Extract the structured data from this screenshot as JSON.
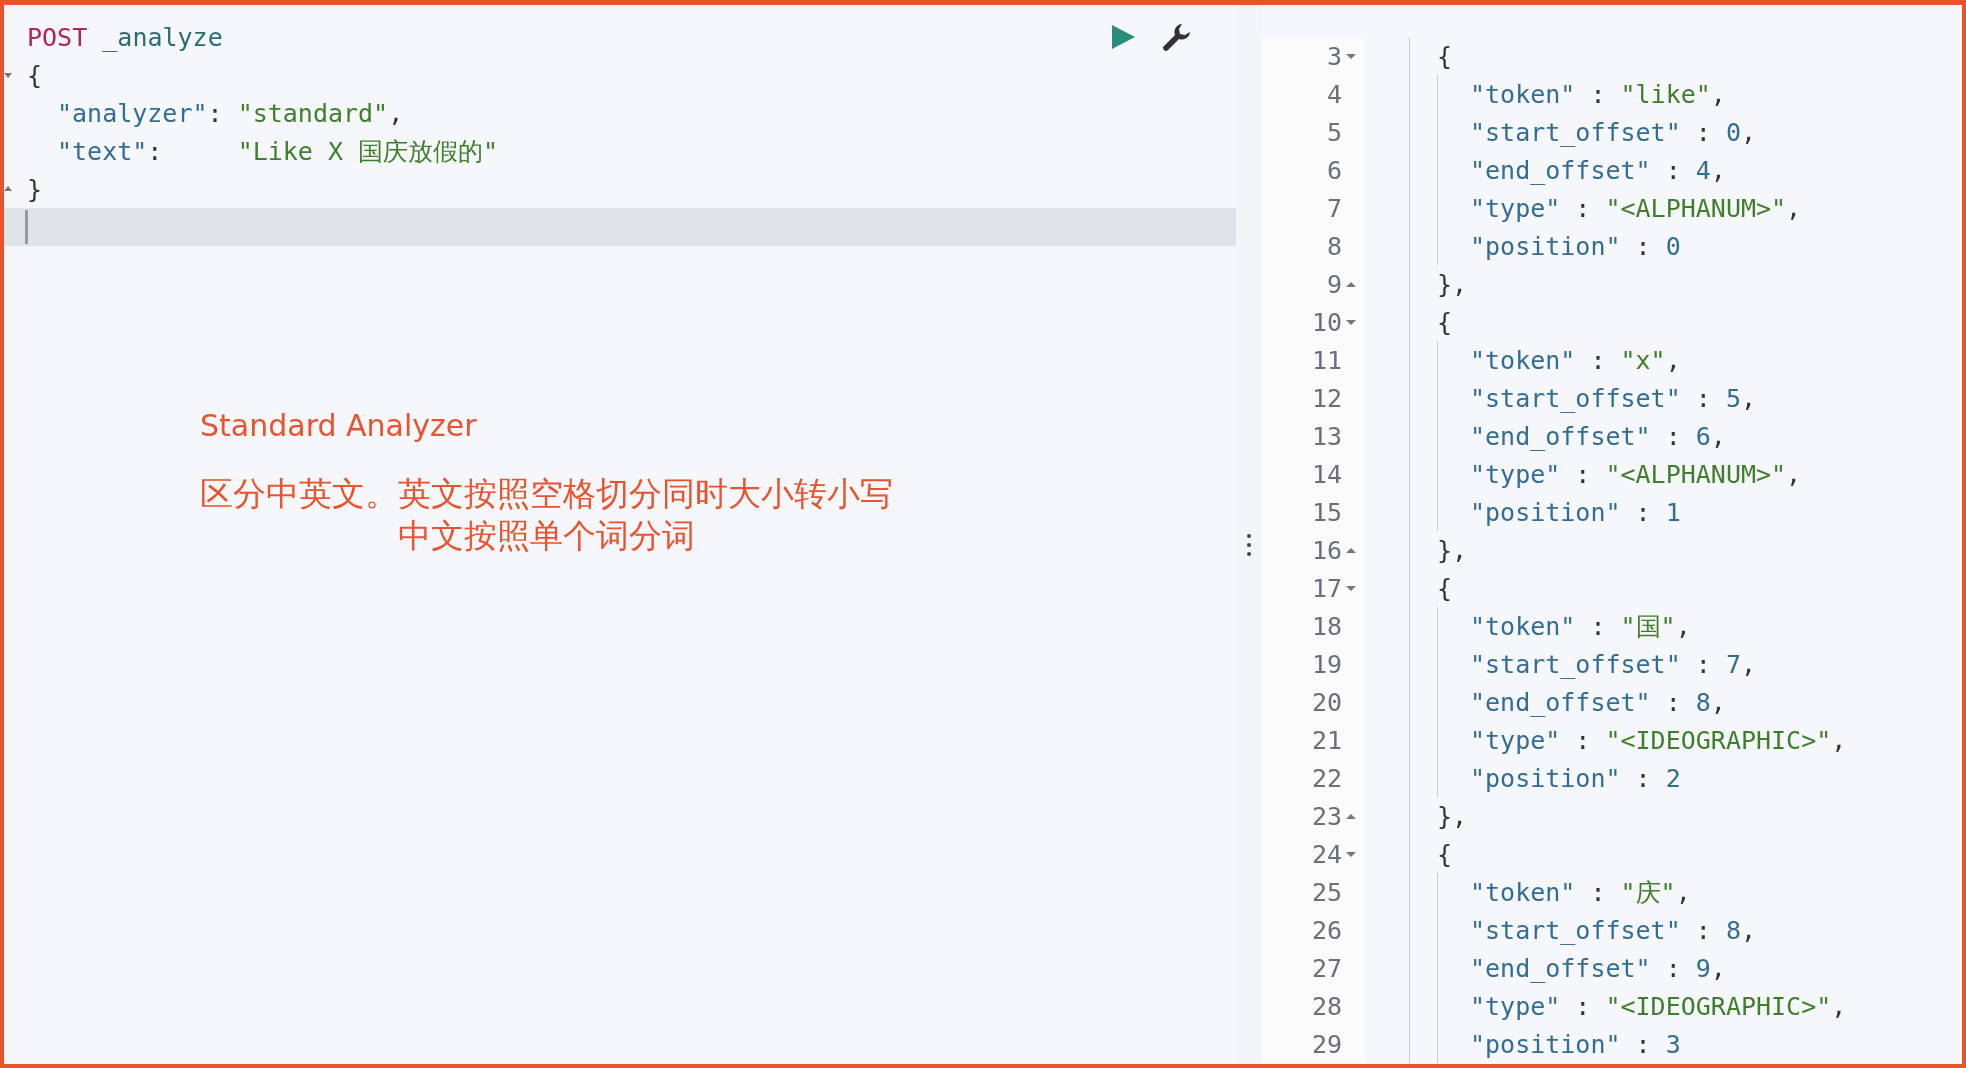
{
  "request": {
    "method": "POST",
    "path": "_analyze",
    "open": "{",
    "fields": [
      {
        "parts": [
          {
            "kind": "key",
            "text": "\"analyzer\""
          },
          {
            "kind": "punct",
            "text": ": "
          },
          {
            "kind": "string",
            "text": "\"standard\""
          },
          {
            "kind": "punct",
            "text": ","
          }
        ]
      },
      {
        "parts": [
          {
            "kind": "key",
            "text": "\"text\""
          },
          {
            "kind": "punct",
            "text": ":     "
          },
          {
            "kind": "string",
            "text": "\"Like X 国庆放假的\""
          }
        ]
      }
    ],
    "close": "}"
  },
  "note": {
    "title": "Standard Analyzer",
    "lines": [
      "区分中英文。英文按照空格切分同时大小转小写",
      "中文按照单个词分词"
    ]
  },
  "response": {
    "tokens": [
      {
        "open_line": "3",
        "open": "{",
        "fields": [
          {
            "line": "4",
            "parts": [
              {
                "kind": "key",
                "text": "\"token\""
              },
              {
                "kind": "punct",
                "text": " : "
              },
              {
                "kind": "string",
                "text": "\"like\""
              },
              {
                "kind": "punct",
                "text": ","
              }
            ]
          },
          {
            "line": "5",
            "parts": [
              {
                "kind": "key",
                "text": "\"start_offset\""
              },
              {
                "kind": "punct",
                "text": " : "
              },
              {
                "kind": "number",
                "text": "0"
              },
              {
                "kind": "punct",
                "text": ","
              }
            ]
          },
          {
            "line": "6",
            "parts": [
              {
                "kind": "key",
                "text": "\"end_offset\""
              },
              {
                "kind": "punct",
                "text": " : "
              },
              {
                "kind": "number",
                "text": "4"
              },
              {
                "kind": "punct",
                "text": ","
              }
            ]
          },
          {
            "line": "7",
            "parts": [
              {
                "kind": "key",
                "text": "\"type\""
              },
              {
                "kind": "punct",
                "text": " : "
              },
              {
                "kind": "string",
                "text": "\"<ALPHANUM>\""
              },
              {
                "kind": "punct",
                "text": ","
              }
            ]
          },
          {
            "line": "8",
            "parts": [
              {
                "kind": "key",
                "text": "\"position\""
              },
              {
                "kind": "punct",
                "text": " : "
              },
              {
                "kind": "number",
                "text": "0"
              }
            ]
          }
        ],
        "close_line": "9",
        "close": "},"
      },
      {
        "open_line": "10",
        "open": "{",
        "fields": [
          {
            "line": "11",
            "parts": [
              {
                "kind": "key",
                "text": "\"token\""
              },
              {
                "kind": "punct",
                "text": " : "
              },
              {
                "kind": "string",
                "text": "\"x\""
              },
              {
                "kind": "punct",
                "text": ","
              }
            ]
          },
          {
            "line": "12",
            "parts": [
              {
                "kind": "key",
                "text": "\"start_offset\""
              },
              {
                "kind": "punct",
                "text": " : "
              },
              {
                "kind": "number",
                "text": "5"
              },
              {
                "kind": "punct",
                "text": ","
              }
            ]
          },
          {
            "line": "13",
            "parts": [
              {
                "kind": "key",
                "text": "\"end_offset\""
              },
              {
                "kind": "punct",
                "text": " : "
              },
              {
                "kind": "number",
                "text": "6"
              },
              {
                "kind": "punct",
                "text": ","
              }
            ]
          },
          {
            "line": "14",
            "parts": [
              {
                "kind": "key",
                "text": "\"type\""
              },
              {
                "kind": "punct",
                "text": " : "
              },
              {
                "kind": "string",
                "text": "\"<ALPHANUM>\""
              },
              {
                "kind": "punct",
                "text": ","
              }
            ]
          },
          {
            "line": "15",
            "parts": [
              {
                "kind": "key",
                "text": "\"position\""
              },
              {
                "kind": "punct",
                "text": " : "
              },
              {
                "kind": "number",
                "text": "1"
              }
            ]
          }
        ],
        "close_line": "16",
        "close": "},"
      },
      {
        "open_line": "17",
        "open": "{",
        "fields": [
          {
            "line": "18",
            "parts": [
              {
                "kind": "key",
                "text": "\"token\""
              },
              {
                "kind": "punct",
                "text": " : "
              },
              {
                "kind": "string",
                "text": "\"国\""
              },
              {
                "kind": "punct",
                "text": ","
              }
            ]
          },
          {
            "line": "19",
            "parts": [
              {
                "kind": "key",
                "text": "\"start_offset\""
              },
              {
                "kind": "punct",
                "text": " : "
              },
              {
                "kind": "number",
                "text": "7"
              },
              {
                "kind": "punct",
                "text": ","
              }
            ]
          },
          {
            "line": "20",
            "parts": [
              {
                "kind": "key",
                "text": "\"end_offset\""
              },
              {
                "kind": "punct",
                "text": " : "
              },
              {
                "kind": "number",
                "text": "8"
              },
              {
                "kind": "punct",
                "text": ","
              }
            ]
          },
          {
            "line": "21",
            "parts": [
              {
                "kind": "key",
                "text": "\"type\""
              },
              {
                "kind": "punct",
                "text": " : "
              },
              {
                "kind": "string",
                "text": "\"<IDEOGRAPHIC>\""
              },
              {
                "kind": "punct",
                "text": ","
              }
            ]
          },
          {
            "line": "22",
            "parts": [
              {
                "kind": "key",
                "text": "\"position\""
              },
              {
                "kind": "punct",
                "text": " : "
              },
              {
                "kind": "number",
                "text": "2"
              }
            ]
          }
        ],
        "close_line": "23",
        "close": "},"
      },
      {
        "open_line": "24",
        "open": "{",
        "fields": [
          {
            "line": "25",
            "parts": [
              {
                "kind": "key",
                "text": "\"token\""
              },
              {
                "kind": "punct",
                "text": " : "
              },
              {
                "kind": "string",
                "text": "\"庆\""
              },
              {
                "kind": "punct",
                "text": ","
              }
            ]
          },
          {
            "line": "26",
            "parts": [
              {
                "kind": "key",
                "text": "\"start_offset\""
              },
              {
                "kind": "punct",
                "text": " : "
              },
              {
                "kind": "number",
                "text": "8"
              },
              {
                "kind": "punct",
                "text": ","
              }
            ]
          },
          {
            "line": "27",
            "parts": [
              {
                "kind": "key",
                "text": "\"end_offset\""
              },
              {
                "kind": "punct",
                "text": " : "
              },
              {
                "kind": "number",
                "text": "9"
              },
              {
                "kind": "punct",
                "text": ","
              }
            ]
          },
          {
            "line": "28",
            "parts": [
              {
                "kind": "key",
                "text": "\"type\""
              },
              {
                "kind": "punct",
                "text": " : "
              },
              {
                "kind": "string",
                "text": "\"<IDEOGRAPHIC>\""
              },
              {
                "kind": "punct",
                "text": ","
              }
            ]
          },
          {
            "line": "29",
            "parts": [
              {
                "kind": "key",
                "text": "\"position\""
              },
              {
                "kind": "punct",
                "text": " : "
              },
              {
                "kind": "number",
                "text": "3"
              }
            ]
          }
        ]
      }
    ]
  }
}
